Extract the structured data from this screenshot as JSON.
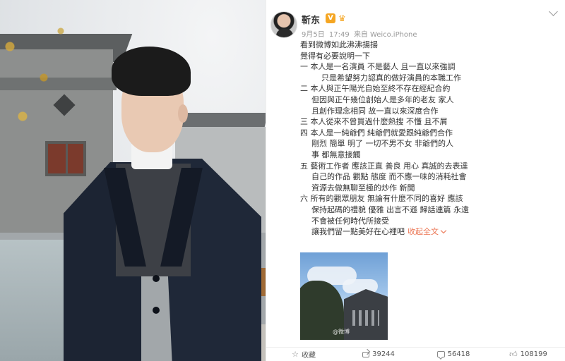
{
  "post": {
    "username": "靳东",
    "meta": {
      "date": "9月5日",
      "time": "17:49",
      "source_prefix": "来自",
      "source": "Weico.iPhone"
    },
    "lines": [
      "看到微博如此沸沸揚揚",
      "覺得有必要說明一下",
      "一 本人是一名演員 不是藝人 且一直以來強調",
      "只是希望努力認真的做好演員的本職工作",
      "二 本人與正午陽光自始至終不存在經紀合約",
      "但因與正午幾位創始人是多年的老友 家人",
      "且創作理念相同 故一直以來深度合作",
      "三 本人從來不曾買過什麼熱搜 不懂 且不屑",
      "四 本人是一純爺們 純爺們就愛跟純爺們合作",
      "剛烈 簡單 明了 一切不男不女 非爺們的人",
      "事 都無意接觸",
      "五 藝術工作者 應該正直 善良 用心 真誠的去表達",
      "自己的作品 觀點 態度 而不應一味的消耗社會",
      "資源去做無聊至極的炒作 新聞",
      "六 所有的觀眾朋友 無論有什麼不同的喜好 應該",
      "保持起碼的禮貌 優雅 出言不遜 歸話連篇 永遠",
      "不會被任何時代所接受",
      "讓我們留一點美好在心裡吧"
    ],
    "expand_label": "收起全文",
    "image_watermark": "@微博",
    "actions": {
      "favorite_label": "收藏",
      "repost_count": "39244",
      "comment_count": "56418",
      "like_count": "108199"
    }
  }
}
